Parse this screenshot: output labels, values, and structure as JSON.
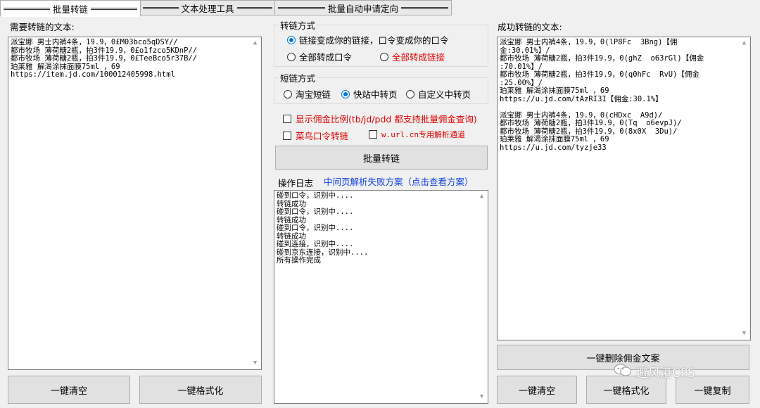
{
  "tabs": [
    {
      "label": "批量转链",
      "active": true
    },
    {
      "label": "文本处理工具",
      "active": false
    },
    {
      "label": "批量自动申请定向",
      "active": false
    }
  ],
  "left": {
    "label": "需要转链的文本:",
    "lines": [
      "派宝娜 男士内裤4条，19.9，0£M03bco5qDSY//",
      "都市牧场 薄荷糖2瓶，拍3件19.9，0£o1fzco5KDnP//",
      "都市牧场 薄荷糖2瓶，拍3件19.9，0£TeeBco5r37B//",
      "珀莱雅 解渴涂抹面膜75ml ，69",
      "https://item.jd.com/100012405998.html"
    ],
    "clear_btn": "一键清空",
    "format_btn": "一键格式化"
  },
  "middle": {
    "convert_mode": {
      "title": "转链方式",
      "opt1": "链接变成你的链接，口令变成你的口令",
      "opt2": "全部转成口令",
      "opt3": "全部转成链接"
    },
    "short_mode": {
      "title": "短链方式",
      "opt1": "淘宝短链",
      "opt2": "快站中转页",
      "opt3": "自定义中转页"
    },
    "check_commission": "显示佣金比例(tb/jd/pdd 都支持批量佣金查询)",
    "check_cainiao": "菜鸟口令转链",
    "check_wurl": "w.url.cn专用解析通道",
    "batch_btn": "批量转链",
    "log_label": "操作日志",
    "log_link": "中间页解析失败方案（点击查看方案）",
    "log_lines": [
      "碰到口令，识别中....",
      "转链成功",
      "碰到口令，识别中....",
      "转链成功",
      "碰到口令，识别中....",
      "转链成功",
      "碰到连接，识别中....",
      "碰到京东连接，识别中....",
      "所有操作完成"
    ]
  },
  "right": {
    "label": "成功转链的文本:",
    "lines": [
      "派宝娜 男士内裤4条，19.9，0(lP8Fc  3Bng)【佣",
      "金:30.01%】/",
      "都市牧场 薄荷糖2瓶，拍3件19.9，0(ghZ  o63rGl)【佣金",
      ":70.01%】/",
      "都市牧场 薄荷糖2瓶，拍3件19.9，0(q0hFc  RvU)【佣金",
      ":25.00%】/",
      "珀莱雅 解渴涂抹面膜75ml ，69",
      "https://u.jd.com/tAzRI3I【佣金:30.1%】",
      "",
      "派宝娜 男士内裤4条，19.9，0(cHDxc  A9d)/",
      "都市牧场 薄荷糖2瓶，拍3件19.9，0(Tq  o6evpJ)/",
      "都市牧场 薄荷糖2瓶，拍3件19.9，0(8x0X  3Du)/",
      "珀莱雅 解渴涂抹面膜75ml ，69",
      "https://u.jd.com/tyzje33"
    ],
    "delete_commission_btn": "一键删除佣金文案",
    "clear_btn": "一键清空",
    "format_btn": "一键格式化",
    "copy_btn": "一键复制"
  },
  "watermark": "避风港CPS"
}
